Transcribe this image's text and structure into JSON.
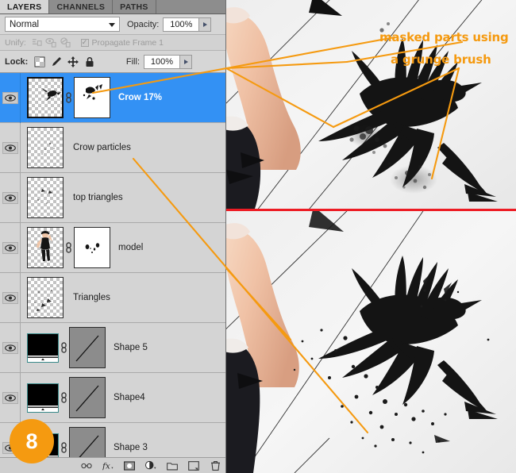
{
  "panel": {
    "tabs": [
      {
        "label": "LAYERS",
        "active": true
      },
      {
        "label": "CHANNELS",
        "active": false
      },
      {
        "label": "PATHS",
        "active": false
      }
    ],
    "blend": {
      "mode": "Normal",
      "opacity_label": "Opacity:",
      "opacity_value": "100%"
    },
    "unify": {
      "label": "Unify:",
      "propagate_label": "Propagate Frame 1",
      "propagate_checked": "✓",
      "icons": [
        "unify-position-icon",
        "unify-visibility-icon",
        "unify-style-icon"
      ]
    },
    "lock": {
      "label": "Lock:",
      "fill_label": "Fill:",
      "fill_value": "100%",
      "icons": [
        "lock-transparency-icon",
        "lock-image-icon",
        "lock-position-icon",
        "lock-all-icon"
      ]
    },
    "toolbar_icons": [
      "link-layers-icon",
      "layer-style-fx-icon",
      "add-layer-mask-icon",
      "new-adjustment-layer-icon",
      "new-group-icon",
      "new-layer-icon",
      "delete-layer-icon"
    ]
  },
  "layers": [
    {
      "name": "Crow 17%",
      "selected": true,
      "visible": true,
      "thumb": "checker",
      "has_mask": true,
      "mask_kind": "white",
      "linked": true
    },
    {
      "name": "Crow particles",
      "selected": false,
      "visible": true,
      "thumb": "checker",
      "has_mask": false,
      "linked": false
    },
    {
      "name": "top triangles",
      "selected": false,
      "visible": true,
      "thumb": "checker",
      "has_mask": false,
      "linked": false
    },
    {
      "name": "model",
      "selected": false,
      "visible": true,
      "thumb": "model-photo",
      "has_mask": true,
      "mask_kind": "white",
      "linked": true
    },
    {
      "name": "Triangles",
      "selected": false,
      "visible": true,
      "thumb": "checker",
      "has_mask": false,
      "linked": false
    },
    {
      "name": "Shape 5",
      "selected": false,
      "visible": true,
      "thumb": "gradient-fill",
      "has_mask": true,
      "mask_kind": "vector",
      "linked": true
    },
    {
      "name": "Shape4",
      "selected": false,
      "visible": true,
      "thumb": "gradient-fill",
      "has_mask": true,
      "mask_kind": "vector",
      "linked": true
    },
    {
      "name": "Shape 3",
      "selected": false,
      "visible": true,
      "thumb": "gradient-fill",
      "has_mask": true,
      "mask_kind": "vector",
      "linked": true
    }
  ],
  "annotation": {
    "line1": "masked parts using",
    "line2": "a grunge brush",
    "color": "#f59a10"
  },
  "step_badge": {
    "number": "8",
    "color": "#f59a10"
  },
  "colors": {
    "panel_bg": "#d4d4d4",
    "selected_row": "#3391f4",
    "divider_red": "#ed1c24",
    "annotation_orange": "#f59a10"
  },
  "canvas": {
    "top_image": "crow-composite-before",
    "bottom_image": "crow-composite-after",
    "divider": "red-separator-line"
  }
}
